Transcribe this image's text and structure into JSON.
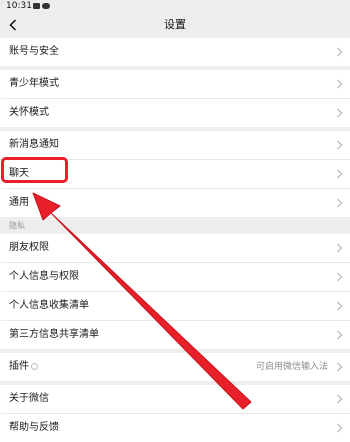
{
  "status_bar": {
    "time": "10:31"
  },
  "header": {
    "title": "设置"
  },
  "rows": {
    "account": "账号与安全",
    "teen": "青少年模式",
    "care": "关怀模式",
    "notify": "新消息通知",
    "chat": "聊天",
    "general": "通用",
    "friends": "朋友权限",
    "personal_info": "个人信息与权限",
    "info_collect": "个人信息收集清单",
    "third_party": "第三方信息共享清单",
    "plugins": "插件",
    "plugins_value": "可启用微信输入法",
    "about": "关于微信",
    "help": "帮助与反馈"
  },
  "sections": {
    "privacy": "隐私"
  },
  "colors": {
    "background": "#ededed",
    "row": "#ffffff",
    "annotation": "#e8202a"
  }
}
